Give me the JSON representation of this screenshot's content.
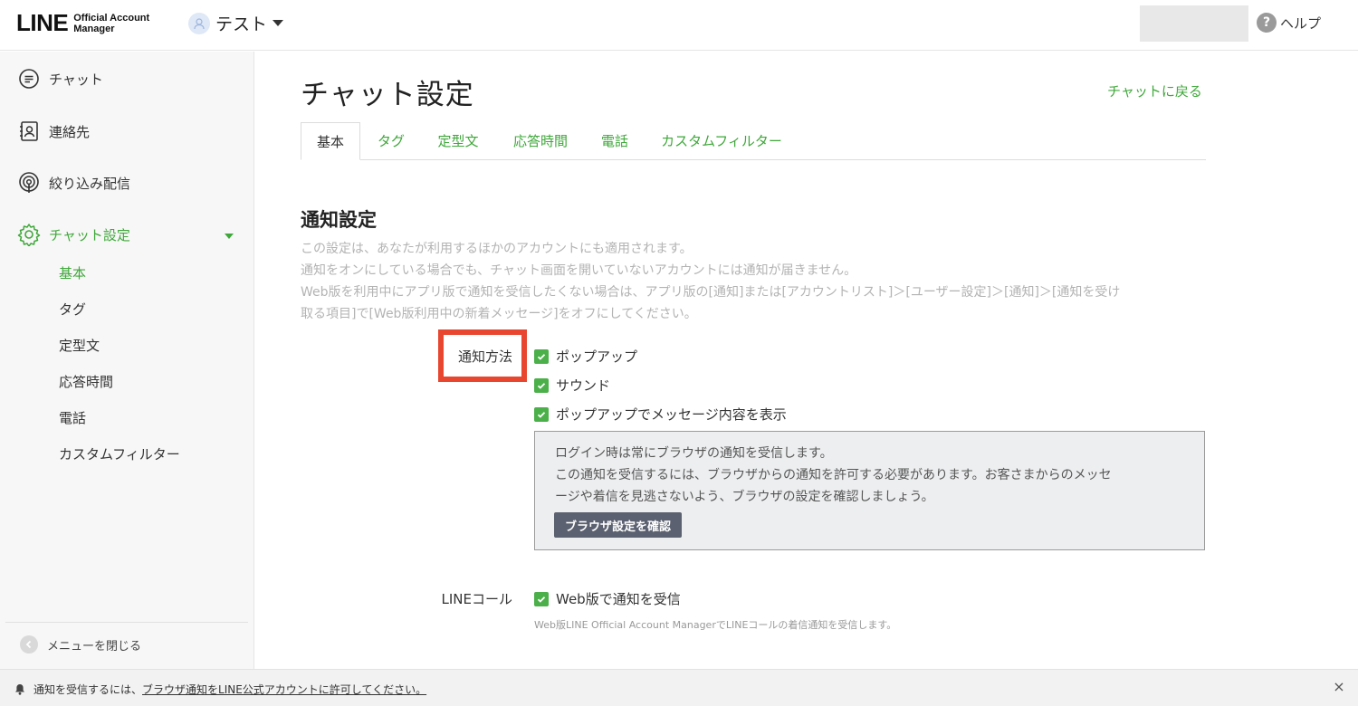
{
  "header": {
    "logo_main": "LINE",
    "logo_sub_line1": "Official Account",
    "logo_sub_line2": "Manager",
    "account_name": "テスト",
    "help_icon_glyph": "?",
    "help_label": "ヘルプ"
  },
  "sidebar": {
    "items": [
      {
        "label": "チャット",
        "icon": "chat-icon"
      },
      {
        "label": "連絡先",
        "icon": "contacts-icon"
      },
      {
        "label": "絞り込み配信",
        "icon": "broadcast-icon"
      },
      {
        "label": "チャット設定",
        "icon": "gear-icon"
      }
    ],
    "sub_items": [
      "基本",
      "タグ",
      "定型文",
      "応答時間",
      "電話",
      "カスタムフィルター"
    ],
    "close_menu_label": "メニューを閉じる"
  },
  "main": {
    "title": "チャット設定",
    "back_link": "チャットに戻る",
    "tabs": [
      "基本",
      "タグ",
      "定型文",
      "応答時間",
      "電話",
      "カスタムフィルター"
    ],
    "section_title": "通知設定",
    "description": [
      "この設定は、あなたが利用するほかのアカウントにも適用されます。",
      "通知をオンにしている場合でも、チャット画面を開いていないアカウントには通知が届きません。",
      "Web版を利用中にアプリ版で通知を受信したくない場合は、アプリ版の[通知]または[アカウントリスト]＞[ユーザー設定]＞[通知]＞[通知を受け",
      "取る項目]で[Web版利用中の新着メッセージ]をオフにしてください。"
    ],
    "notify_method_label": "通知方法",
    "notify_options": [
      {
        "label": "ポップアップ",
        "checked": true
      },
      {
        "label": "サウンド",
        "checked": true
      },
      {
        "label": "ポップアップでメッセージ内容を表示",
        "checked": true
      }
    ],
    "info_lines": [
      "ログイン時は常にブラウザの通知を受信します。",
      "この通知を受信するには、ブラウザからの通知を許可する必要があります。お客さまからのメッセ",
      "ージや着信を見逃さないよう、ブラウザの設定を確認しましょう。"
    ],
    "info_button": "ブラウザ設定を確認",
    "line_call_label": "LINEコール",
    "line_call_option": {
      "label": "Web版で通知を受信",
      "checked": true
    },
    "line_call_note": "Web版LINE Official Account ManagerでLINEコールの着信通知を受信します。"
  },
  "bottom_bar": {
    "message_prefix": "通知を受信するには、",
    "message_link": "ブラウザ通知をLINE公式アカウントに許可してください。",
    "close_glyph": "×"
  },
  "colors": {
    "accent_green": "#3fa83a",
    "checkbox_green": "#4cb04a",
    "highlight_red": "#e8462f",
    "button_dark": "#5b6170"
  }
}
